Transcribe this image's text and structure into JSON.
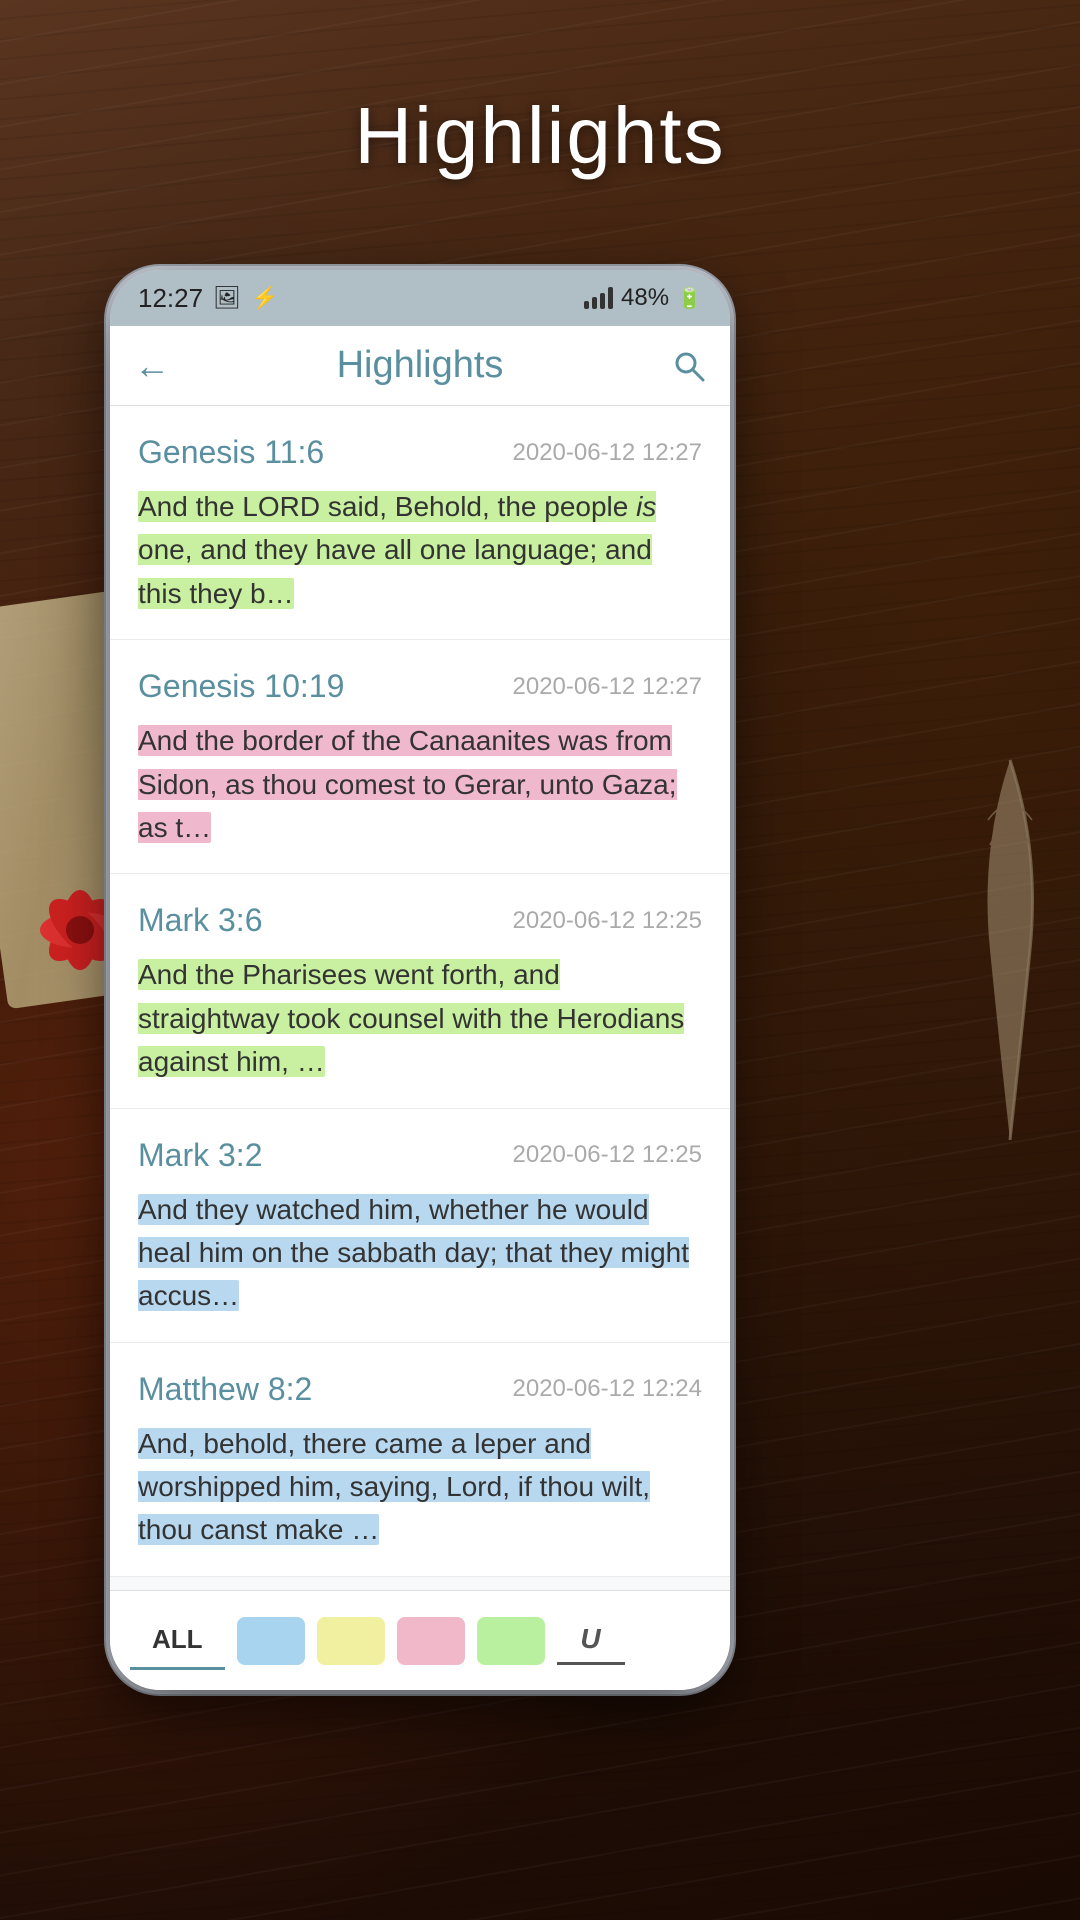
{
  "page": {
    "title": "Highlights",
    "background_color": "#3a2010"
  },
  "status_bar": {
    "time": "12:27",
    "battery": "48%",
    "icons": [
      "photo",
      "bluetooth"
    ]
  },
  "header": {
    "back_label": "←",
    "title": "Highlights",
    "search_icon": "🔍"
  },
  "highlights": [
    {
      "reference": "Genesis 11:6",
      "date": "2020-06-12 12:27",
      "text": "And the LORD said, Behold, the people is one, and they have all one language; and this they b…",
      "highlight_color": "green",
      "highlight_class": "highlight-green"
    },
    {
      "reference": "Genesis 10:19",
      "date": "2020-06-12 12:27",
      "text": "And the border of the Canaanites was from Sidon, as thou comest to Gerar, unto Gaza; as t…",
      "highlight_color": "pink",
      "highlight_class": "highlight-pink"
    },
    {
      "reference": "Mark 3:6",
      "date": "2020-06-12 12:25",
      "text": "And the Pharisees went forth, and straightway took counsel with the Herodians against him, …",
      "highlight_color": "green",
      "highlight_class": "highlight-green"
    },
    {
      "reference": "Mark 3:2",
      "date": "2020-06-12 12:25",
      "text": "And they watched him, whether he would heal him on the sabbath day; that they might accus…",
      "highlight_color": "blue",
      "highlight_class": "highlight-blue"
    },
    {
      "reference": "Matthew 8:2",
      "date": "2020-06-12 12:24",
      "text": "And, behold, there came a leper and worshipped him, saying, Lord, if thou wilt, thou canst make …",
      "highlight_color": "blue",
      "highlight_class": "highlight-blue"
    }
  ],
  "filter_bar": {
    "all_label": "ALL",
    "colors": [
      "#a8d4f0",
      "#f0f0a0",
      "#f0b8c8",
      "#b8f0a0"
    ],
    "underline_label": "U"
  }
}
